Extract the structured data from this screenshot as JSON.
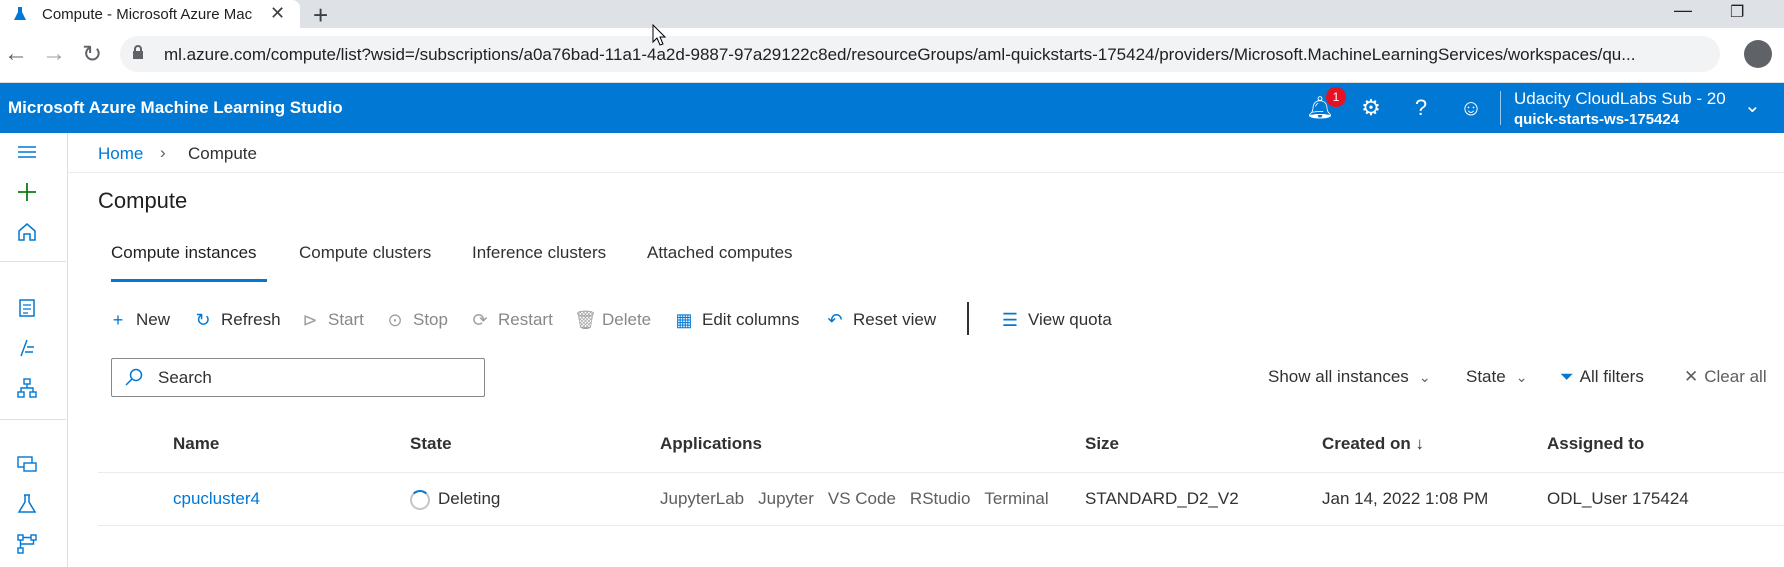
{
  "browser": {
    "tab_title": "Compute - Microsoft Azure Mac",
    "url": "ml.azure.com/compute/list?wsid=/subscriptions/a0a76bad-11a1-4a2d-9887-97a29122c8ed/resourceGroups/aml-quickstarts-175424/providers/Microsoft.MachineLearningServices/workspaces/qu..."
  },
  "header": {
    "brand": "Microsoft Azure Machine Learning Studio",
    "notification_count": "1",
    "account": "Udacity CloudLabs Sub - 20",
    "workspace": "quick-starts-ws-175424",
    "accent": "#0078d4"
  },
  "breadcrumb": {
    "home": "Home",
    "current": "Compute"
  },
  "page": {
    "title": "Compute",
    "tabs": [
      {
        "label": "Compute instances",
        "selected": true
      },
      {
        "label": "Compute clusters",
        "selected": false
      },
      {
        "label": "Inference clusters",
        "selected": false
      },
      {
        "label": "Attached computes",
        "selected": false
      }
    ]
  },
  "commands": {
    "new": "New",
    "refresh": "Refresh",
    "start": "Start",
    "stop": "Stop",
    "restart": "Restart",
    "delete": "Delete",
    "edit_columns": "Edit columns",
    "reset_view": "Reset view",
    "view_quota": "View quota"
  },
  "search": {
    "placeholder": "Search",
    "value": ""
  },
  "filters": {
    "instances": "Show all instances",
    "state": "State",
    "all_filters": "All filters",
    "clear_all": "Clear all"
  },
  "table": {
    "columns": [
      "Name",
      "State",
      "Applications",
      "Size",
      "Created on ↓",
      "Assigned to"
    ],
    "rows": [
      {
        "name": "cpucluster4",
        "state": "Deleting",
        "applications": [
          "JupyterLab",
          "Jupyter",
          "VS Code",
          "RStudio",
          "Terminal"
        ],
        "size": "STANDARD_D2_V2",
        "created_on": "Jan 14, 2022 1:08 PM",
        "assigned_to": "ODL_User 175424"
      }
    ]
  }
}
